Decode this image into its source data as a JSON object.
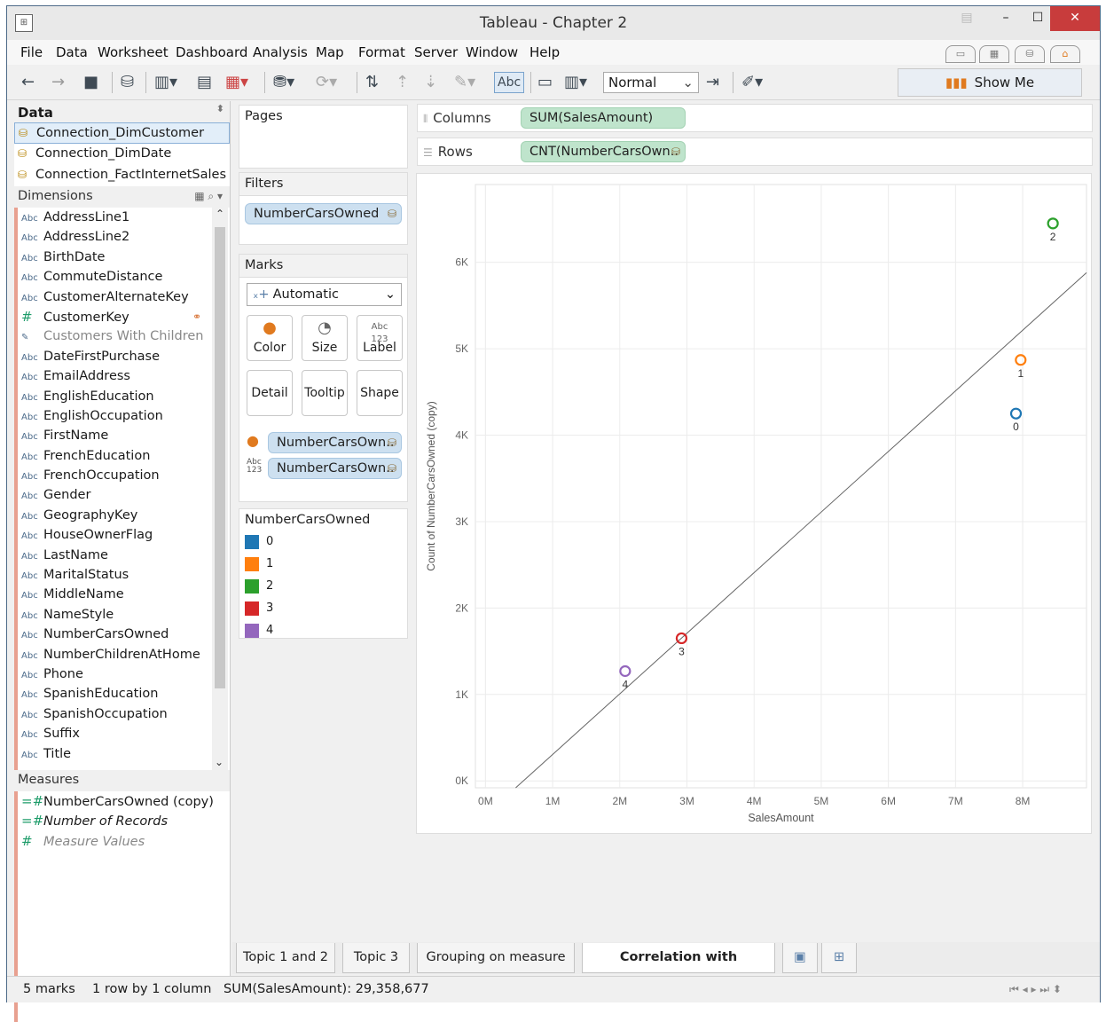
{
  "window": {
    "title": "Tableau - Chapter 2"
  },
  "menu": [
    "File",
    "Data",
    "Worksheet",
    "Dashboard",
    "Analysis",
    "Map",
    "Format",
    "Server",
    "Window",
    "Help"
  ],
  "toolbar": {
    "label_btn": "Abc",
    "fit": "Normal",
    "show_me": "Show Me"
  },
  "data_pane": {
    "title": "Data",
    "connections": [
      "Connection_DimCustomer",
      "Connection_DimDate",
      "Connection_FactInternetSales"
    ],
    "dimensions_label": "Dimensions",
    "dimensions": [
      {
        "type": "Abc",
        "name": "AddressLine1"
      },
      {
        "type": "Abc",
        "name": "AddressLine2"
      },
      {
        "type": "Abc",
        "name": "BirthDate"
      },
      {
        "type": "Abc",
        "name": "CommuteDistance"
      },
      {
        "type": "Abc",
        "name": "CustomerAlternateKey"
      },
      {
        "type": "#",
        "name": "CustomerKey"
      },
      {
        "type": "set",
        "name": "Customers With Children"
      },
      {
        "type": "Abc",
        "name": "DateFirstPurchase"
      },
      {
        "type": "Abc",
        "name": "EmailAddress"
      },
      {
        "type": "Abc",
        "name": "EnglishEducation"
      },
      {
        "type": "Abc",
        "name": "EnglishOccupation"
      },
      {
        "type": "Abc",
        "name": "FirstName"
      },
      {
        "type": "Abc",
        "name": "FrenchEducation"
      },
      {
        "type": "Abc",
        "name": "FrenchOccupation"
      },
      {
        "type": "Abc",
        "name": "Gender"
      },
      {
        "type": "Abc",
        "name": "GeographyKey"
      },
      {
        "type": "Abc",
        "name": "HouseOwnerFlag"
      },
      {
        "type": "Abc",
        "name": "LastName"
      },
      {
        "type": "Abc",
        "name": "MaritalStatus"
      },
      {
        "type": "Abc",
        "name": "MiddleName"
      },
      {
        "type": "Abc",
        "name": "NameStyle"
      },
      {
        "type": "Abc",
        "name": "NumberCarsOwned"
      },
      {
        "type": "Abc",
        "name": "NumberChildrenAtHome"
      },
      {
        "type": "Abc",
        "name": "Phone"
      },
      {
        "type": "Abc",
        "name": "SpanishEducation"
      },
      {
        "type": "Abc",
        "name": "SpanishOccupation"
      },
      {
        "type": "Abc",
        "name": "Suffix"
      },
      {
        "type": "Abc",
        "name": "Title"
      }
    ],
    "measures_label": "Measures",
    "measures": [
      {
        "type": "=#",
        "name": "NumberCarsOwned (copy)"
      },
      {
        "type": "=#",
        "name": "Number of Records"
      },
      {
        "type": "#",
        "name": "Measure Values"
      }
    ]
  },
  "cards": {
    "pages": "Pages",
    "filters": "Filters",
    "filter_pill": "NumberCarsOwned",
    "marks": "Marks",
    "mark_type": "Automatic",
    "mark_buttons": [
      "Color",
      "Size",
      "Label",
      "Detail",
      "Tooltip",
      "Shape"
    ],
    "mark_pills": [
      "NumberCarsOwn..",
      "NumberCarsOwn.."
    ],
    "legend_title": "NumberCarsOwned",
    "legend": [
      {
        "label": "0",
        "color": "#1f77b4"
      },
      {
        "label": "1",
        "color": "#ff7f0e"
      },
      {
        "label": "2",
        "color": "#2ca02c"
      },
      {
        "label": "3",
        "color": "#d62728"
      },
      {
        "label": "4",
        "color": "#9467bd"
      }
    ]
  },
  "shelves": {
    "columns_label": "Columns",
    "columns_pill": "SUM(SalesAmount)",
    "rows_label": "Rows",
    "rows_pill": "CNT(NumberCarsOwn.."
  },
  "chart_data": {
    "type": "scatter",
    "xlabel": "SalesAmount",
    "ylabel": "Count of NumberCarsOwned (copy)",
    "x_ticks": [
      "0M",
      "1M",
      "2M",
      "3M",
      "4M",
      "5M",
      "6M",
      "7M",
      "8M"
    ],
    "y_ticks": [
      "0K",
      "1K",
      "2K",
      "3K",
      "4K",
      "5K",
      "6K"
    ],
    "xlim": [
      -150000,
      8950000
    ],
    "ylim": [
      -80000,
      6900
    ],
    "points": [
      {
        "label": "0",
        "x": 7900000,
        "y": 4250,
        "color": "#1f77b4"
      },
      {
        "label": "1",
        "x": 7970000,
        "y": 4870,
        "color": "#ff7f0e"
      },
      {
        "label": "2",
        "x": 8450000,
        "y": 6450,
        "color": "#2ca02c"
      },
      {
        "label": "3",
        "x": 2920000,
        "y": 1650,
        "color": "#d62728"
      },
      {
        "label": "4",
        "x": 2080000,
        "y": 1270,
        "color": "#9467bd"
      }
    ],
    "trend_line": {
      "x0": 450000,
      "y0": -80,
      "x1": 8950000,
      "y1": 5880
    }
  },
  "tabs": [
    "Topic 1 and 2",
    "Topic 3",
    "Grouping on measure",
    "Correlation with Calculation"
  ],
  "status": {
    "marks": "5 marks",
    "dims": "1 row by 1 column",
    "sum": "SUM(SalesAmount): 29,358,677"
  }
}
